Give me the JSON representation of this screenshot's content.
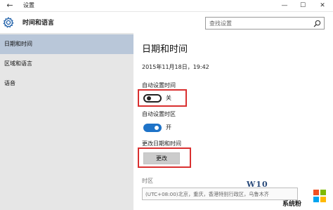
{
  "window": {
    "title": "设置",
    "back_label": "←",
    "minimize_label": "—",
    "maximize_label": "☐",
    "close_label": "✕"
  },
  "header": {
    "title": "时间和语言",
    "icon": "gear-icon"
  },
  "search": {
    "placeholder": "查找设置",
    "icon": "search-icon"
  },
  "sidebar": {
    "items": [
      {
        "label": "日期和时间",
        "active": true
      },
      {
        "label": "区域和语言",
        "active": false
      },
      {
        "label": "语音",
        "active": false
      }
    ]
  },
  "main": {
    "heading": "日期和时间",
    "current_datetime": "2015年11月18日，19:42",
    "auto_time": {
      "label": "自动设置时间",
      "state_label": "关",
      "on": false
    },
    "auto_timezone": {
      "label": "自动设置时区",
      "state_label": "开",
      "on": true
    },
    "change_datetime": {
      "label": "更改日期和时间",
      "button_label": "更改"
    },
    "timezone": {
      "label": "时区",
      "value": "(UTC+08:00)北京，重庆，香港特别行政区，乌鲁木齐"
    }
  },
  "watermark": {
    "win_text": "W10",
    "brand_text": "系统粉"
  },
  "colors": {
    "sidebar_bg": "#e6e6e6",
    "sidebar_active": "#b9c7d9",
    "toggle_on": "#1e73c8",
    "highlight_red": "#d93030",
    "button_bg": "#cccccc"
  }
}
